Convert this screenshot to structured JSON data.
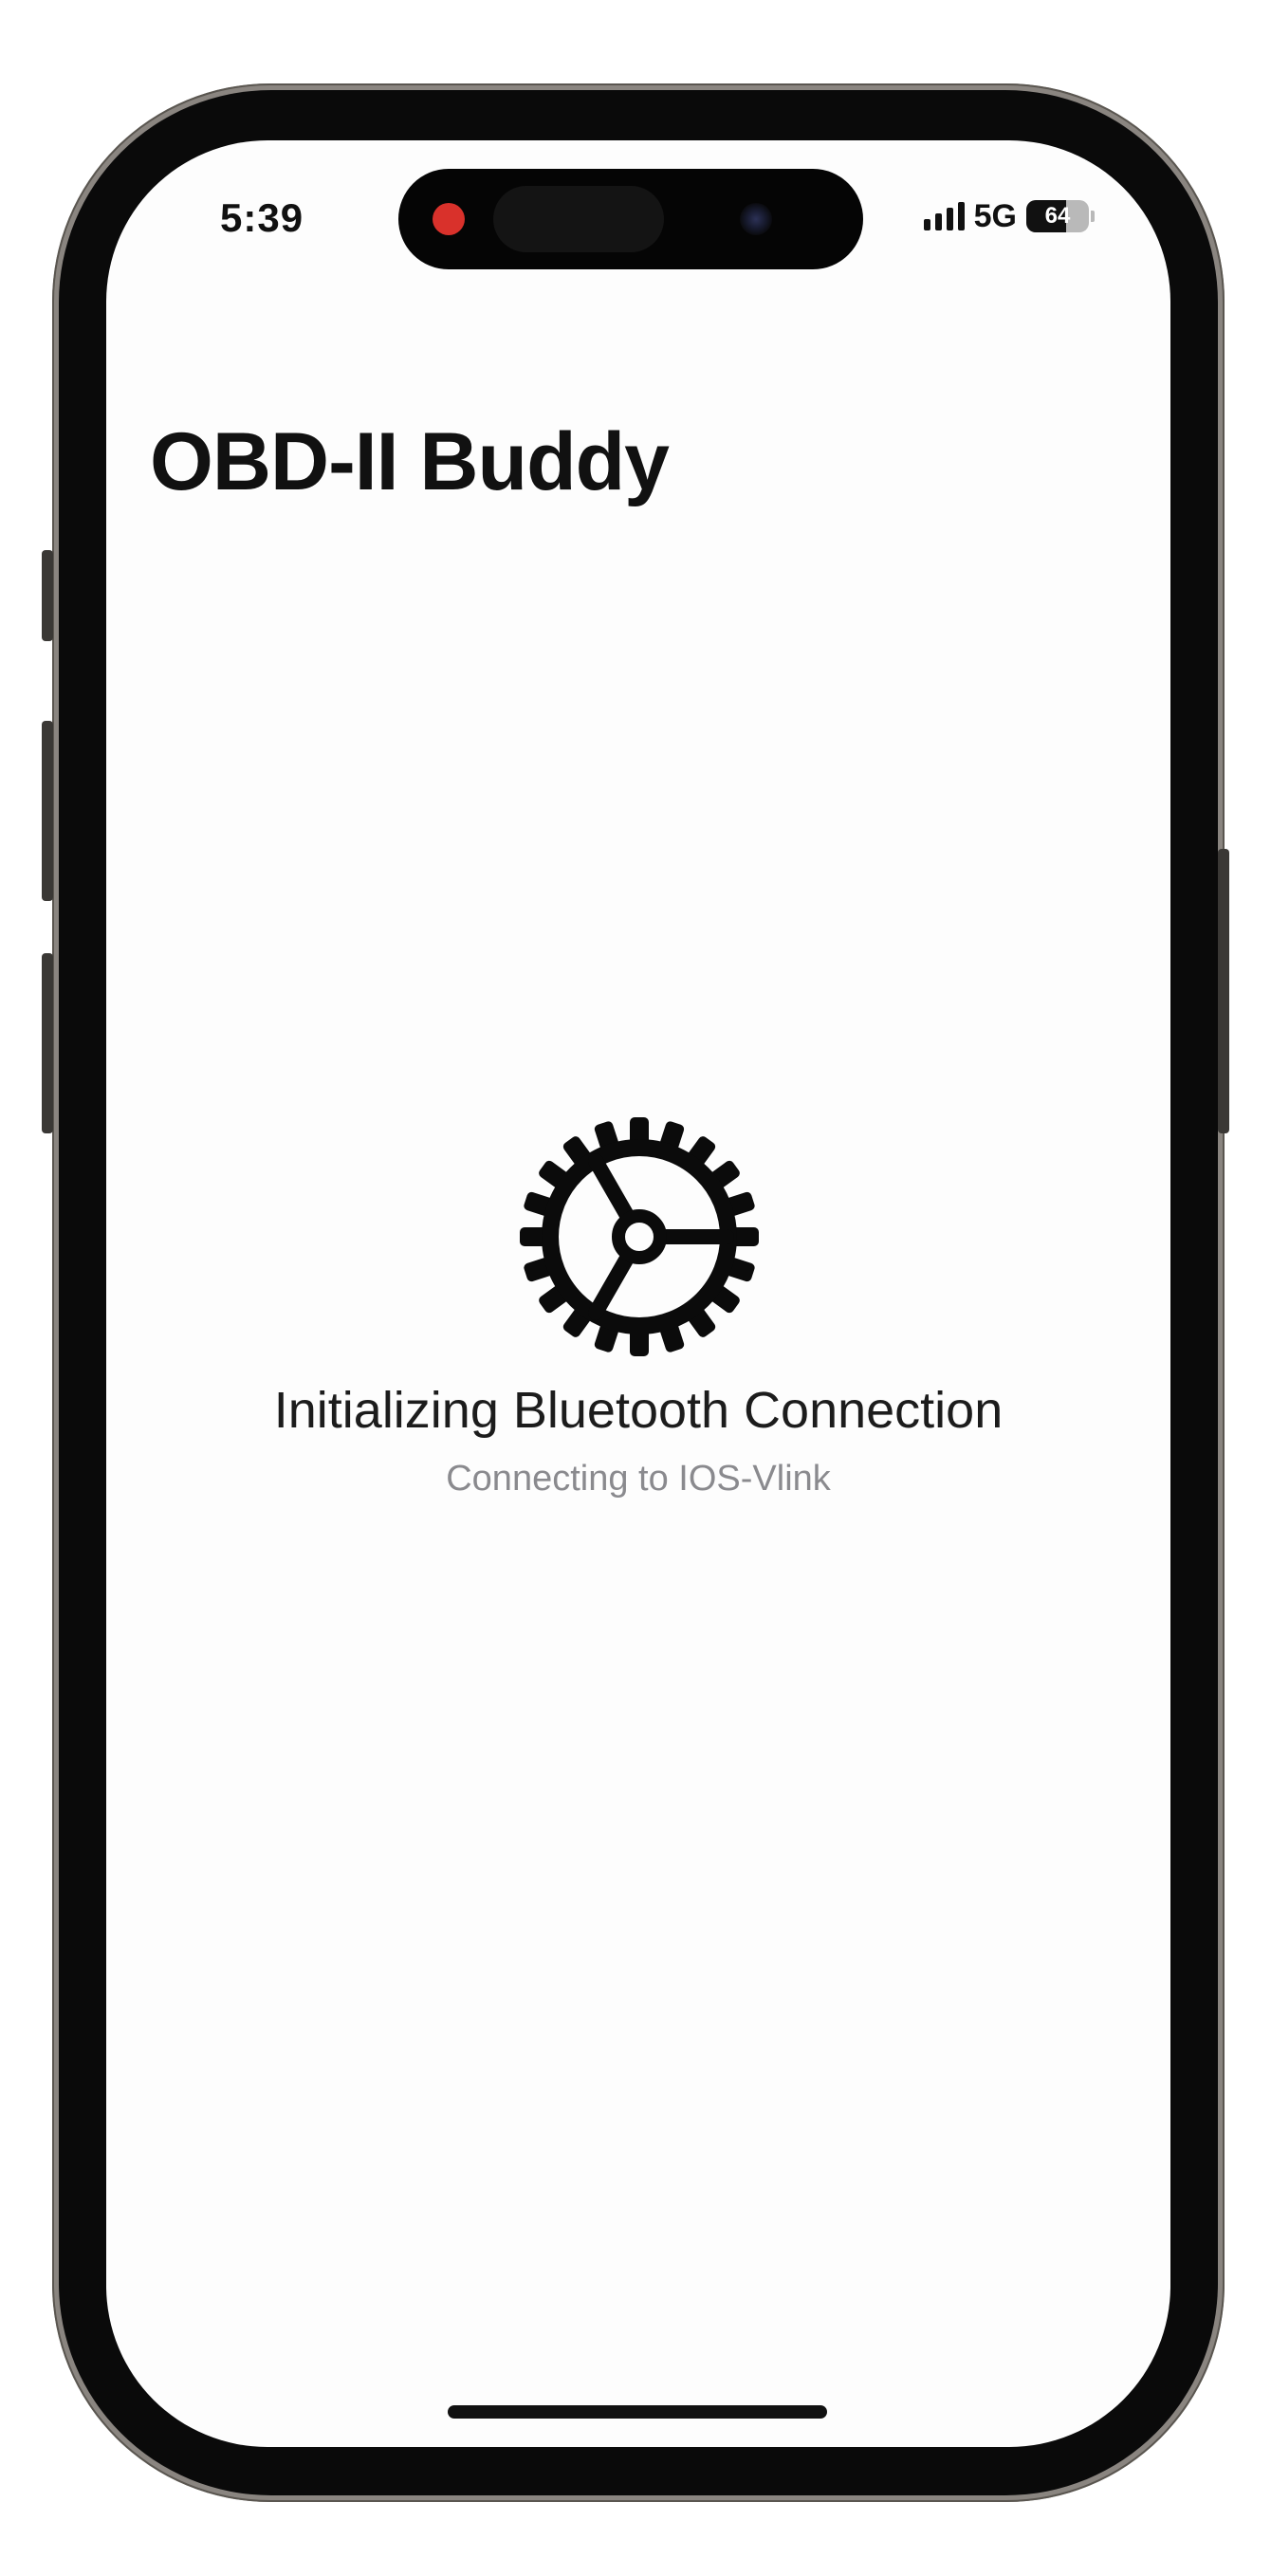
{
  "status_bar": {
    "time": "5:39",
    "network": "5G",
    "battery": "64",
    "battery_fraction": 0.64,
    "signal_bars_active": 4
  },
  "header": {
    "title": "OBD-II Buddy"
  },
  "loading": {
    "icon": "gear-icon",
    "title": "Initializing Bluetooth Connection",
    "subtitle": "Connecting to IOS-Vlink"
  },
  "colors": {
    "recording_indicator": "#d9312b",
    "subtitle_gray": "#8a8a8e",
    "text_primary": "#111111"
  }
}
